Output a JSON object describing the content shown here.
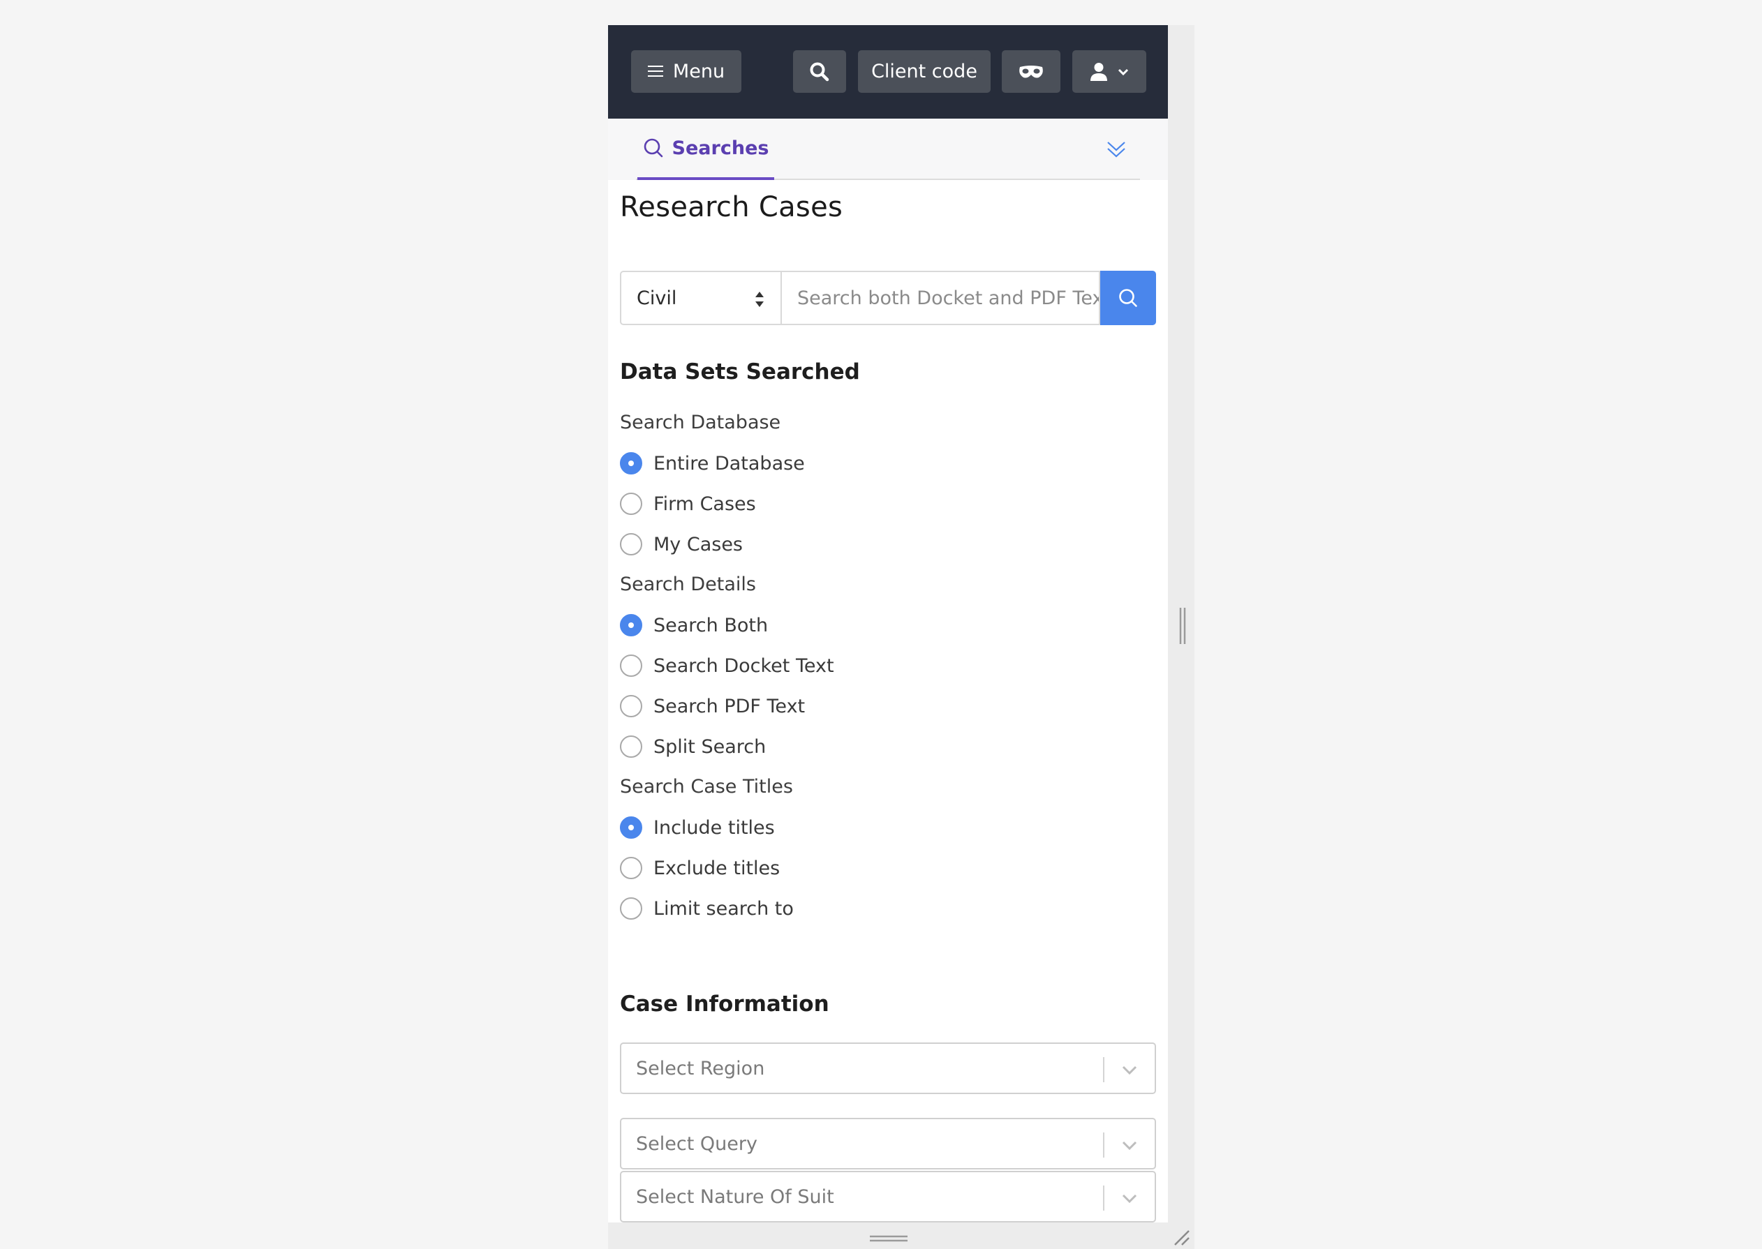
{
  "header": {
    "menu_label": "Menu",
    "client_code_label": "Client code"
  },
  "tabs": {
    "active_label": "Searches"
  },
  "page": {
    "title": "Research Cases"
  },
  "search": {
    "case_type_value": "Civil",
    "placeholder": "Search both Docket and PDF Text"
  },
  "data_sets": {
    "heading": "Data Sets Searched",
    "groups": [
      {
        "label": "Search Database",
        "options": [
          {
            "label": "Entire Database",
            "checked": true
          },
          {
            "label": "Firm Cases",
            "checked": false
          },
          {
            "label": "My Cases",
            "checked": false
          }
        ]
      },
      {
        "label": "Search Details",
        "options": [
          {
            "label": "Search Both",
            "checked": true
          },
          {
            "label": "Search Docket Text",
            "checked": false
          },
          {
            "label": "Search PDF Text",
            "checked": false
          },
          {
            "label": "Split Search",
            "checked": false
          }
        ]
      },
      {
        "label": "Search Case Titles",
        "options": [
          {
            "label": "Include titles",
            "checked": true
          },
          {
            "label": "Exclude titles",
            "checked": false
          },
          {
            "label": "Limit search to",
            "checked": false
          }
        ]
      }
    ]
  },
  "case_info": {
    "heading": "Case Information",
    "region_placeholder": "Select Region",
    "query_placeholder": "Select Query",
    "nature_placeholder": "Select Nature Of Suit"
  },
  "colors": {
    "topbar": "#262c3a",
    "accent_blue": "#4a86ec",
    "tab_purple": "#5b3fb0"
  }
}
